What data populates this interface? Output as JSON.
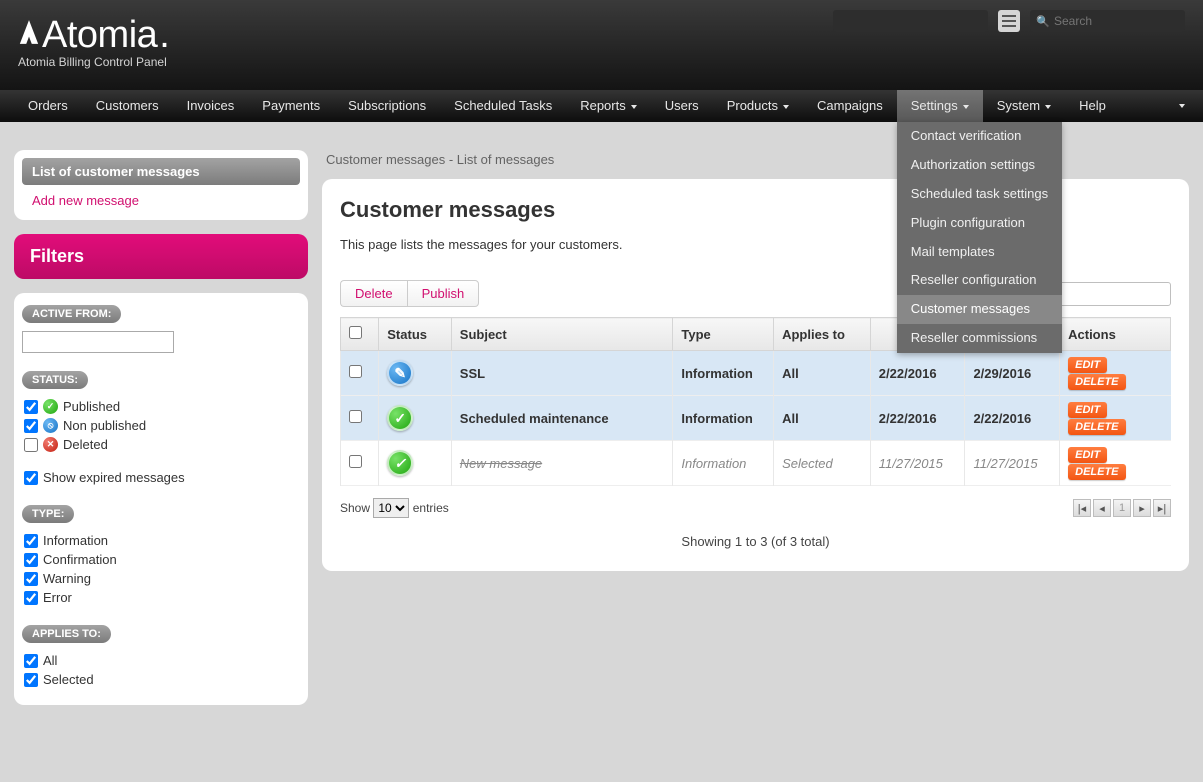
{
  "brand": {
    "name": "Atomia",
    "sub": "Atomia Billing Control Panel"
  },
  "topsearch": {
    "placeholder": "Search"
  },
  "nav": {
    "items": [
      {
        "label": "Orders"
      },
      {
        "label": "Customers"
      },
      {
        "label": "Invoices"
      },
      {
        "label": "Payments"
      },
      {
        "label": "Subscriptions"
      },
      {
        "label": "Scheduled Tasks"
      },
      {
        "label": "Reports",
        "caret": true
      },
      {
        "label": "Users"
      },
      {
        "label": "Products",
        "caret": true
      },
      {
        "label": "Campaigns"
      },
      {
        "label": "Settings",
        "caret": true,
        "open": true
      },
      {
        "label": "System",
        "caret": true
      },
      {
        "label": "Help"
      }
    ],
    "settings_dropdown": [
      "Contact verification",
      "Authorization settings",
      "Scheduled task settings",
      "Plugin configuration",
      "Mail templates",
      "Reseller configuration",
      "Customer messages",
      "Reseller commissions"
    ],
    "settings_highlight": "Customer messages"
  },
  "sidebar": {
    "list_title": "List of customer messages",
    "add_link": "Add new message",
    "filters_title": "Filters",
    "groups": {
      "active_from": {
        "chip": "ACTIVE FROM:"
      },
      "status": {
        "chip": "STATUS:",
        "items": [
          {
            "label": "Published",
            "icon": "green",
            "checked": true
          },
          {
            "label": "Non published",
            "icon": "blue",
            "checked": true
          },
          {
            "label": "Deleted",
            "icon": "red",
            "checked": false
          }
        ],
        "show_expired": {
          "label": "Show expired messages",
          "checked": true
        }
      },
      "type": {
        "chip": "TYPE:",
        "items": [
          {
            "label": "Information",
            "checked": true
          },
          {
            "label": "Confirmation",
            "checked": true
          },
          {
            "label": "Warning",
            "checked": true
          },
          {
            "label": "Error",
            "checked": true
          }
        ]
      },
      "applies": {
        "chip": "APPLIES TO:",
        "items": [
          {
            "label": "All",
            "checked": true
          },
          {
            "label": "Selected",
            "checked": true
          }
        ]
      }
    }
  },
  "main": {
    "breadcrumb": "Customer messages - List of messages",
    "title": "Customer messages",
    "desc": "This page lists the messages for your customers.",
    "toolbar": {
      "delete": "Delete",
      "publish": "Publish"
    },
    "columns": {
      "status": "Status",
      "subject": "Subject",
      "type": "Type",
      "applies": "Applies to",
      "actions": "Actions"
    },
    "rows": [
      {
        "status": "blue",
        "subject": "SSL",
        "type": "Information",
        "applies": "All",
        "from": "2/22/2016",
        "to": "2/29/2016",
        "expired": false
      },
      {
        "status": "green",
        "subject": "Scheduled maintenance",
        "type": "Information",
        "applies": "All",
        "from": "2/22/2016",
        "to": "2/22/2016",
        "expired": false
      },
      {
        "status": "green",
        "subject": "New message",
        "type": "Information",
        "applies": "Selected",
        "from": "11/27/2015",
        "to": "11/27/2015",
        "expired": true
      }
    ],
    "actions": {
      "edit": "EDIT",
      "delete": "DELETE"
    },
    "footer": {
      "show": "Show",
      "entries": "entries",
      "page_size": "10",
      "summary": "Showing 1 to 3 (of 3 total)",
      "page": "1"
    }
  }
}
